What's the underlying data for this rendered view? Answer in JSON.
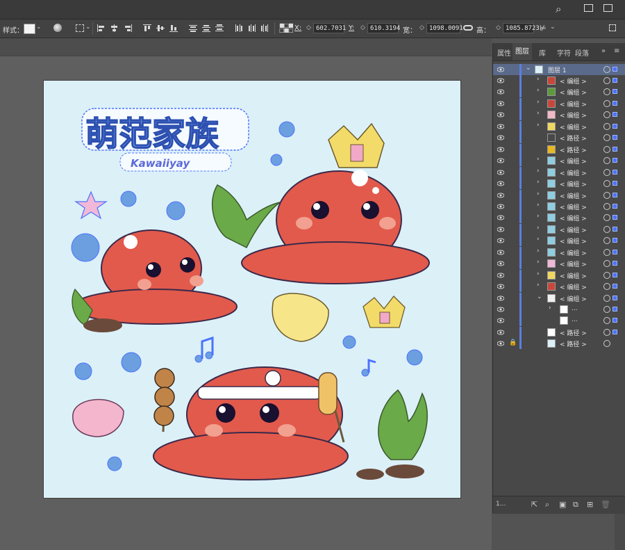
{
  "controlbar": {
    "style_label": "样式：",
    "x_label": "X:",
    "x_value": "602.7031",
    "y_label": "Y:",
    "y_value": "610.3194",
    "w_label": "宽：",
    "w_value": "1098.0091",
    "h_label": "高：",
    "h_value": "1085.8723"
  },
  "panel": {
    "tabs": [
      "属性",
      "图层",
      "库",
      "字符",
      "段落"
    ],
    "active_tab": "图层",
    "more": "»",
    "layer_name": "图层 1",
    "footer_count": "1..."
  },
  "layers": [
    {
      "name": "< 编组 >",
      "thumb": "#c9473a"
    },
    {
      "name": "< 编组 >",
      "thumb": "#5c9a3c"
    },
    {
      "name": "< 编组 >",
      "thumb": "#c9473a"
    },
    {
      "name": "< 编组 >",
      "thumb": "#f2b8c8"
    },
    {
      "name": "< 编组 >",
      "thumb": "#f0d860"
    },
    {
      "name": "< 路径 >",
      "thumb": ""
    },
    {
      "name": "< 路径 >",
      "thumb": "#e8b820"
    },
    {
      "name": "< 编组 >",
      "thumb": "#8fcde0"
    },
    {
      "name": "< 编组 >",
      "thumb": "#8fcde0"
    },
    {
      "name": "< 编组 >",
      "thumb": "#8fcde0"
    },
    {
      "name": "< 编组 >",
      "thumb": "#8fcde0"
    },
    {
      "name": "< 编组 >",
      "thumb": "#8fcde0"
    },
    {
      "name": "< 编组 >",
      "thumb": "#8fcde0"
    },
    {
      "name": "< 编组 >",
      "thumb": "#8fcde0"
    },
    {
      "name": "< 编组 >",
      "thumb": "#8fcde0"
    },
    {
      "name": "< 编组 >",
      "thumb": "#8fcde0"
    },
    {
      "name": "< 编组 >",
      "thumb": "#f2b8d8"
    },
    {
      "name": "< 编组 >",
      "thumb": "#f0d860"
    },
    {
      "name": "< 编组 >",
      "thumb": "#c9473a"
    },
    {
      "name": "< 编组 >",
      "thumb": "#f0f0f0"
    },
    {
      "name": "...",
      "thumb": "#ffffff"
    },
    {
      "name": "...",
      "thumb": "#ffffff"
    },
    {
      "name": "< 路径 >",
      "thumb": "#ffffff"
    },
    {
      "name": "< 路径 >",
      "thumb": "#dcf0f8"
    }
  ],
  "artwork": {
    "title_text": "萌范家族",
    "subtitle_text": "Kawaiiyay"
  },
  "colors": {
    "artboard_bg": "#dcf0f8",
    "octopus": "#e25a4c",
    "selection": "#4b72ff",
    "crown": "#f0d860",
    "seaweed": "#5c9a3c"
  }
}
